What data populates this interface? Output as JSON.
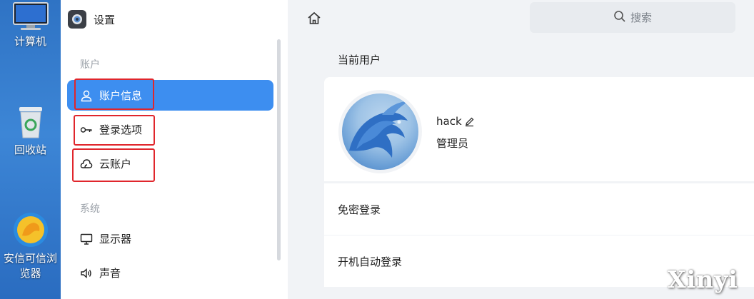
{
  "desktop": {
    "icons": [
      {
        "label": "计算机",
        "icon": "monitor-icon"
      },
      {
        "label": "回收站",
        "icon": "trash-icon"
      },
      {
        "label_line1": "安信可信浏",
        "label_line2": "览器",
        "icon": "browser-icon"
      }
    ]
  },
  "sidebar": {
    "app_title": "设置",
    "section_account": "账户",
    "section_system": "系统",
    "items": [
      {
        "label": "账户信息",
        "icon": "user-icon",
        "active": true
      },
      {
        "label": "登录选项",
        "icon": "key-icon"
      },
      {
        "label": "云账户",
        "icon": "cloud-icon"
      },
      {
        "label": "显示器",
        "icon": "display-icon"
      },
      {
        "label": "声音",
        "icon": "speaker-icon"
      }
    ]
  },
  "main": {
    "search_placeholder": "搜索",
    "current_user_title": "当前用户",
    "user": {
      "name": "hack",
      "role": "管理员"
    },
    "rows": [
      {
        "label": "免密登录"
      },
      {
        "label": "开机自动登录"
      }
    ]
  },
  "watermark": "Xinyi",
  "colors": {
    "accent": "#3d8ef0",
    "highlight_box": "#e0262c"
  }
}
